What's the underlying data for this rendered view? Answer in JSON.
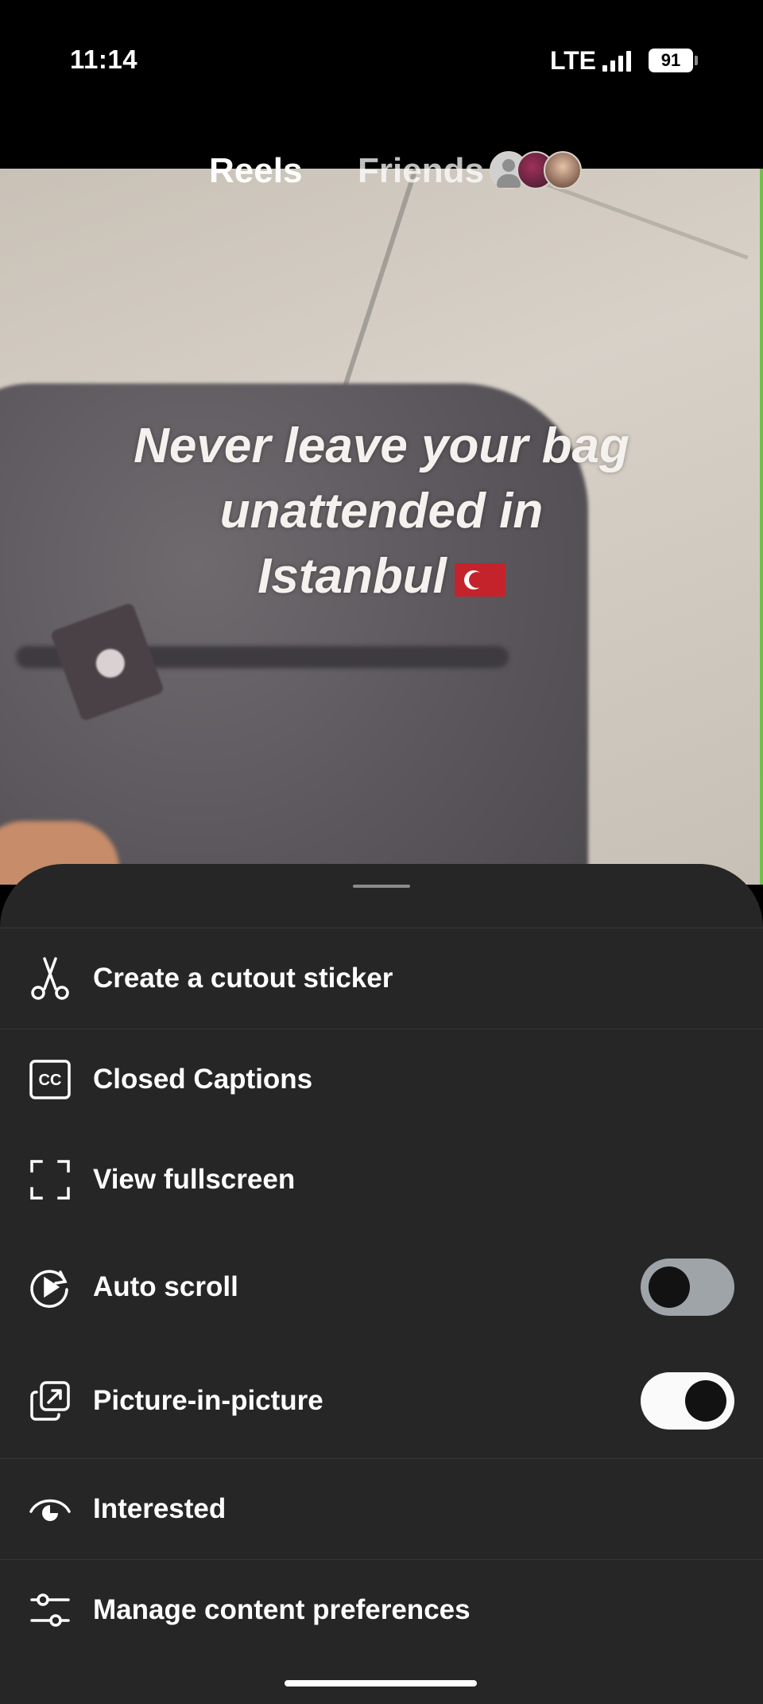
{
  "status_bar": {
    "time": "11:14",
    "network": "LTE",
    "battery": "91"
  },
  "top_tabs": {
    "reels": "Reels",
    "friends": "Friends"
  },
  "video": {
    "caption_line1": "Never leave your bag",
    "caption_line2": "unattended in",
    "caption_line3": "Istanbul"
  },
  "menu": {
    "items": [
      {
        "label": "Create a cutout sticker",
        "icon": "scissors-icon"
      },
      {
        "label": "Closed Captions",
        "icon": "cc-icon"
      },
      {
        "label": "View fullscreen",
        "icon": "fullscreen-icon"
      },
      {
        "label": "Auto scroll",
        "icon": "auto-scroll-icon",
        "toggle": "off"
      },
      {
        "label": "Picture-in-picture",
        "icon": "pip-icon",
        "toggle": "on"
      },
      {
        "label": "Interested",
        "icon": "interested-eye-icon"
      },
      {
        "label": "Manage content preferences",
        "icon": "sliders-icon"
      }
    ]
  },
  "colors": {
    "sheet_background": "#262626",
    "toggle_off": "#9fa4a9",
    "toggle_on": "#fafafa"
  }
}
